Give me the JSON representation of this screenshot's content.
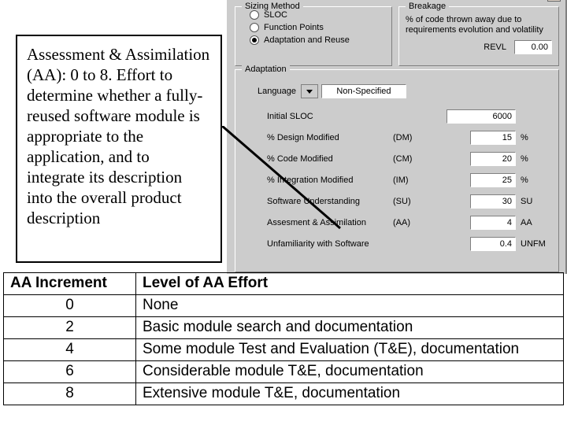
{
  "sizing": {
    "title": "Sizing Method",
    "options": [
      {
        "label": "SLOC",
        "checked": false
      },
      {
        "label": "Function Points",
        "checked": false
      },
      {
        "label": "Adaptation and Reuse",
        "checked": true
      }
    ]
  },
  "breakage": {
    "title": "Breakage",
    "desc": "% of code thrown away due to requirements evolution and volatility",
    "revl_label": "REVL",
    "revl_value": "0.00"
  },
  "adaptation": {
    "title": "Adaptation",
    "language_label": "Language",
    "language_value": "Non-Specified",
    "rows": [
      {
        "label": "Initial SLOC",
        "code": "",
        "value": "6000",
        "unit": ""
      },
      {
        "label": "% Design Modified",
        "code": "(DM)",
        "value": "15",
        "unit": "%"
      },
      {
        "label": "% Code Modified",
        "code": "(CM)",
        "value": "20",
        "unit": "%"
      },
      {
        "label": "% Integration Modified",
        "code": "(IM)",
        "value": "25",
        "unit": "%"
      },
      {
        "label": "Software Understanding",
        "code": "(SU)",
        "value": "30",
        "unit": "SU"
      },
      {
        "label": "Assesment & Assimilation",
        "code": "(AA)",
        "value": "4",
        "unit": "AA"
      },
      {
        "label": "Unfamiliarity with Software",
        "code": "",
        "value": "0.4",
        "unit": "UNFM"
      }
    ]
  },
  "callout": {
    "text": "Assessment & Assimilation (AA): 0 to 8. Effort to determine whether\na fully-reused software module is appropriate to the application, and to integrate its description into the overall product description"
  },
  "aa_table": {
    "headers": [
      "AA Increment",
      "Level of AA Effort"
    ],
    "rows": [
      [
        "0",
        "None"
      ],
      [
        "2",
        "Basic module search and documentation"
      ],
      [
        "4",
        "Some module Test and Evaluation (T&E), documentation"
      ],
      [
        "6",
        "Considerable module T&E, documentation"
      ],
      [
        "8",
        "Extensive module T&E, documentation"
      ]
    ]
  }
}
